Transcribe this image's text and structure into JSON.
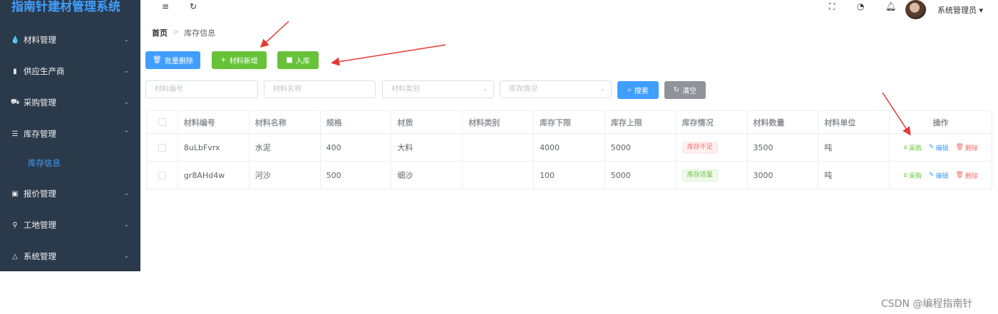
{
  "app": {
    "title": "指南针建材管理系统"
  },
  "sidebar": {
    "items": [
      {
        "icon": "water-drop-icon",
        "label": "材料管理",
        "arrow": "⌄"
      },
      {
        "icon": "building-icon",
        "label": "供应生产商",
        "arrow": "⌄"
      },
      {
        "icon": "cart-icon",
        "label": "采购管理",
        "arrow": "⌄"
      },
      {
        "icon": "database-icon",
        "label": "库存管理",
        "arrow": "⌃"
      },
      {
        "icon": "money-icon",
        "label": "报价管理",
        "arrow": "⌄"
      },
      {
        "icon": "location-pin-icon",
        "label": "工地管理",
        "arrow": "⌄"
      },
      {
        "icon": "flask-icon",
        "label": "系统管理",
        "arrow": "⌄"
      }
    ],
    "sub_item": {
      "label": "库存信息"
    }
  },
  "header": {
    "user_name": "系统管理员 ▾"
  },
  "breadcrumb": {
    "home": "首页",
    "separator": ">",
    "current": "库存信息"
  },
  "toolbar": {
    "batch_delete": "批量删除",
    "add_material": "材料新增",
    "stock_in": "入库"
  },
  "filters": {
    "material_code": "材料编号",
    "material_name": "材料名称",
    "material_category": "材料类别",
    "stock_status": "库存情况",
    "search": "搜索",
    "clear": "清空"
  },
  "table": {
    "headers": [
      "材料编号",
      "材料名称",
      "规格",
      "材质",
      "材料类别",
      "库存下限",
      "库存上限",
      "库存情况",
      "材料数量",
      "材料单位",
      "操作"
    ],
    "rows": [
      {
        "code": "8uLbFvrx",
        "name": "水泥",
        "spec": "400",
        "texture": "大料",
        "category": "",
        "min": "4000",
        "max": "5000",
        "status": "库存不足",
        "quantity": "3500",
        "unit": "吨"
      },
      {
        "code": "gr8AHd4w",
        "name": "河沙",
        "spec": "500",
        "texture": "细沙",
        "category": "",
        "min": "100",
        "max": "5000",
        "status": "库存适量",
        "quantity": "3000",
        "unit": "吨"
      }
    ],
    "actions": {
      "purchase": "采购",
      "edit": "编辑",
      "delete": "删除"
    }
  },
  "watermark": "CSDN @编程指南针",
  "colors": {
    "primary": "#409eff",
    "success": "#67c23a",
    "danger": "#f56c6c",
    "sidebar_bg": "#2b3a4a",
    "arrow": "#e53935"
  }
}
